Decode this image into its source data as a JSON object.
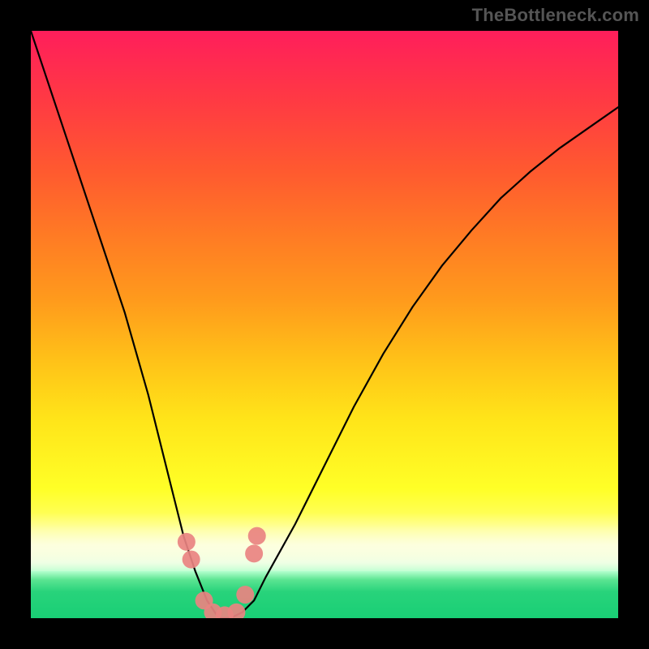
{
  "watermark": "TheBottleneck.com",
  "chart_data": {
    "type": "line",
    "title": "",
    "xlabel": "",
    "ylabel": "",
    "xlim": [
      0,
      100
    ],
    "ylim": [
      0,
      100
    ],
    "grid": false,
    "legend": false,
    "x": [
      0,
      2,
      4,
      6,
      8,
      10,
      12,
      14,
      16,
      18,
      20,
      22,
      24,
      26,
      28,
      30,
      32,
      34,
      36,
      38,
      40,
      45,
      50,
      55,
      60,
      65,
      70,
      75,
      80,
      85,
      90,
      95,
      100
    ],
    "values": [
      100,
      94,
      88,
      82,
      76,
      70,
      64,
      58,
      52,
      45,
      38,
      30,
      22,
      14,
      8,
      3,
      0,
      0,
      1,
      3,
      7,
      16,
      26,
      36,
      45,
      53,
      60,
      66,
      71.5,
      76,
      80,
      83.5,
      87
    ],
    "markers": {
      "x": [
        26.5,
        27.3,
        29.5,
        31,
        33,
        35,
        36.5,
        38,
        38.5
      ],
      "y": [
        13,
        10,
        3,
        1,
        0.5,
        1,
        4,
        11,
        14
      ]
    },
    "background_gradient_stops": [
      {
        "pos": 0.0,
        "color": "#ff1e5b"
      },
      {
        "pos": 0.12,
        "color": "#ff3a43"
      },
      {
        "pos": 0.24,
        "color": "#ff5a2f"
      },
      {
        "pos": 0.35,
        "color": "#ff7b24"
      },
      {
        "pos": 0.46,
        "color": "#ff9b1c"
      },
      {
        "pos": 0.56,
        "color": "#ffc118"
      },
      {
        "pos": 0.66,
        "color": "#ffe419"
      },
      {
        "pos": 0.78,
        "color": "#ffff27"
      },
      {
        "pos": 0.84,
        "color": "#ffff67"
      },
      {
        "pos": 0.88,
        "color": "#f6ffd1"
      },
      {
        "pos": 0.905,
        "color": "#e6ffe4"
      },
      {
        "pos": 0.92,
        "color": "#b4ffce"
      },
      {
        "pos": 0.935,
        "color": "#5ae491"
      },
      {
        "pos": 0.955,
        "color": "#28d37b"
      },
      {
        "pos": 1.0,
        "color": "#19cf75"
      }
    ]
  }
}
